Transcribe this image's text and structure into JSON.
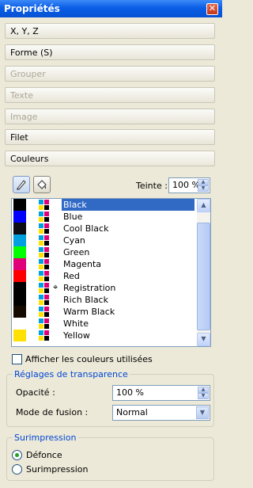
{
  "window": {
    "title": "Propriétés",
    "close_glyph": "✕"
  },
  "sections": [
    {
      "label": "X, Y, Z",
      "state": "enabled"
    },
    {
      "label": "Forme (S)",
      "state": "enabled"
    },
    {
      "label": "Grouper",
      "state": "disabled"
    },
    {
      "label": "Texte",
      "state": "disabled"
    },
    {
      "label": "Image",
      "state": "disabled"
    },
    {
      "label": "Filet",
      "state": "enabled"
    },
    {
      "label": "Couleurs",
      "state": "active"
    }
  ],
  "colors_panel": {
    "tools": [
      "pen-icon",
      "fill-bucket-icon"
    ],
    "tint_label": "Teinte :",
    "tint_value": "100 %",
    "swatches": [
      {
        "name": "Black",
        "color": "#000000",
        "selected": true
      },
      {
        "name": "Blue",
        "color": "#0000ff"
      },
      {
        "name": "Cool Black",
        "color": "#0d0d16"
      },
      {
        "name": "Cyan",
        "color": "#00a0e0"
      },
      {
        "name": "Green",
        "color": "#00ff00"
      },
      {
        "name": "Magenta",
        "color": "#e0007a"
      },
      {
        "name": "Red",
        "color": "#ff0000"
      },
      {
        "name": "Registration",
        "color": "#000000",
        "registration": true
      },
      {
        "name": "Rich Black",
        "color": "#000000"
      },
      {
        "name": "Warm Black",
        "color": "#140a00"
      },
      {
        "name": "White",
        "color": "#ffffff"
      },
      {
        "name": "Yellow",
        "color": "#ffe000"
      }
    ],
    "show_used_label": "Afficher les couleurs utilisées",
    "show_used_checked": false
  },
  "transparency": {
    "title": "Réglages de transparence",
    "opacity_label": "Opacité :",
    "opacity_value": "100 %",
    "blend_label": "Mode de fusion :",
    "blend_value": "Normal"
  },
  "overprint": {
    "title": "Surimpression",
    "options": [
      {
        "label": "Défonce",
        "checked": true
      },
      {
        "label": "Surimpression",
        "checked": false
      }
    ]
  }
}
